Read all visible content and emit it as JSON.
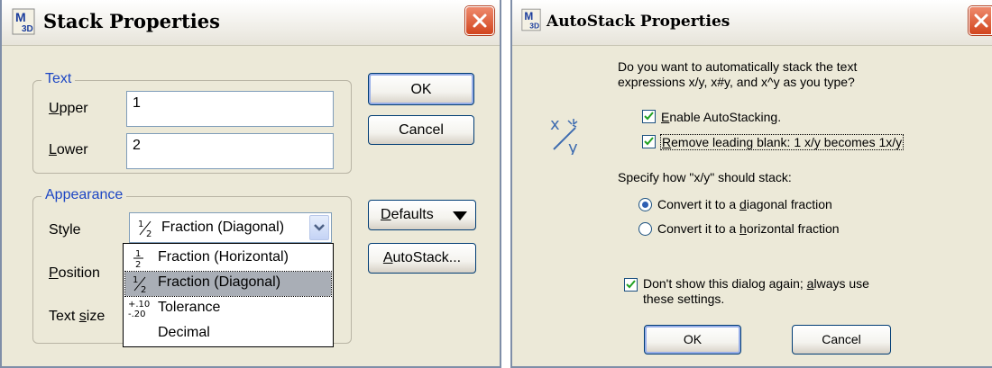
{
  "stack_dialog": {
    "title": "Stack Properties",
    "text_group": {
      "legend": "Text",
      "upper_label_accel": "U",
      "upper_label_rest": "pper",
      "upper_value": "1",
      "lower_label_accel": "L",
      "lower_label_rest": "ower",
      "lower_value": "2"
    },
    "appearance_group": {
      "legend": "Appearance",
      "style_label": "Style",
      "style_selected": "Fraction (Diagonal)",
      "position_label_accel": "P",
      "position_label_rest": "osition",
      "textsize_label_pre": "Text ",
      "textsize_label_accel": "s",
      "textsize_label_rest": "ize",
      "style_options": [
        {
          "label": "Fraction (Horizontal)",
          "icon": "fraction-horizontal-icon"
        },
        {
          "label": "Fraction (Diagonal)",
          "icon": "fraction-diagonal-icon",
          "selected": true
        },
        {
          "label": "Tolerance",
          "icon": "tolerance-icon"
        },
        {
          "label": "Decimal",
          "icon": ""
        }
      ]
    },
    "buttons": {
      "ok": "OK",
      "cancel": "Cancel",
      "defaults_accel": "D",
      "defaults_rest": "efaults",
      "autostack_accel": "A",
      "autostack_rest": "utoStack..."
    }
  },
  "autostack_dialog": {
    "title": "AutoStack Properties",
    "intro_line1": "Do you want to automatically stack the text",
    "intro_line2": "expressions x/y, x#y, and x^y as you type?",
    "enable_accel": "E",
    "enable_rest": "nable AutoStacking.",
    "enable_checked": true,
    "remove_accel": "R",
    "remove_rest": "emove leading blank:  1 x/y  becomes  1x/y",
    "remove_checked": true,
    "specify_text": "Specify how \"x/y\" should stack:",
    "diag_pre": "Convert it to a ",
    "diag_accel": "d",
    "diag_rest": "iagonal fraction",
    "diag_selected": true,
    "horiz_pre": "Convert it to a ",
    "horiz_accel": "h",
    "horiz_rest": "orizontal fraction",
    "horiz_selected": false,
    "dontshow_line1_pre": "Don't show this dialog again; ",
    "dontshow_line1_accel": "a",
    "dontshow_line1_rest": "lways use",
    "dontshow_line2": "these settings.",
    "dontshow_checked": true,
    "ok": "OK",
    "cancel": "Cancel"
  },
  "colors": {
    "dialog_bg": "#ece9d8",
    "group_legend": "#1c46c4",
    "close_button": "#d2451e",
    "selected_option_bg": "#a9aeb6"
  }
}
